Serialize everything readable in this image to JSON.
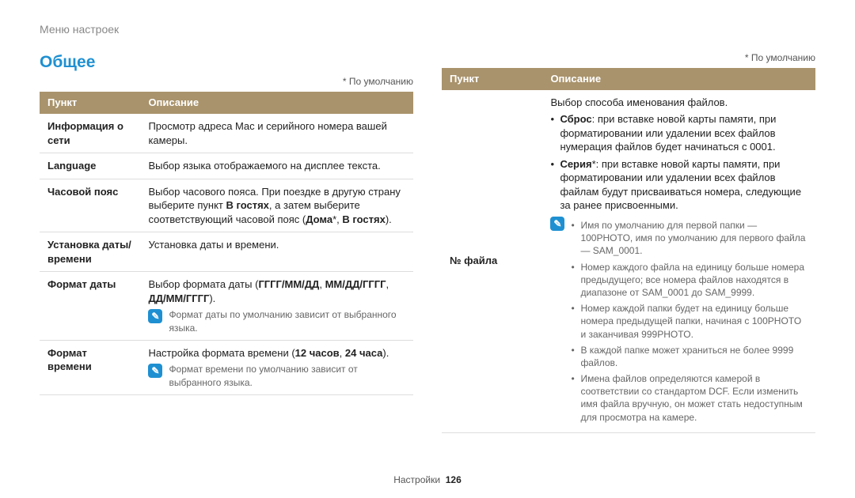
{
  "breadcrumb": "Меню настроек",
  "heading": "Общее",
  "default_note": "* По умолчанию",
  "header_item": "Пункт",
  "header_desc": "Описание",
  "footer_section": "Настройки",
  "footer_page": "126",
  "left": {
    "r0_item": "Информация о сети",
    "r0_desc": "Просмотр адреса Mac и серийного номера вашей камеры.",
    "r1_item": "Language",
    "r1_desc": "Выбор языка отображаемого на дисплее текста.",
    "r2_item": "Часовой пояс",
    "r2_desc_a": "Выбор часового пояса. При поездке в другую страну выберите пункт ",
    "r2_desc_b": "В гостях",
    "r2_desc_c": ", а затем выберите соответствующий часовой пояс (",
    "r2_desc_d": "Дома",
    "r2_desc_e": "*, ",
    "r2_desc_f": "В гостях",
    "r2_desc_g": ").",
    "r3_item": "Установка даты/времени",
    "r3_desc": "Установка даты и времени.",
    "r4_item": "Формат даты",
    "r4_desc_a": "Выбор формата даты (",
    "r4_desc_b": "ГГГГ/ММ/ДД",
    "r4_desc_c": ", ",
    "r4_desc_d": "ММ/ДД/ГГГГ",
    "r4_desc_e": ", ",
    "r4_desc_f": "ДД/ММ/ГГГГ",
    "r4_desc_g": ").",
    "r4_note": "Формат даты по умолчанию зависит от выбранного языка.",
    "r5_item": "Формат времени",
    "r5_desc_a": "Настройка формата времени (",
    "r5_desc_b": "12 часов",
    "r5_desc_c": ", ",
    "r5_desc_d": "24 часа",
    "r5_desc_e": ").",
    "r5_note": "Формат времени по умолчанию зависит от выбранного языка."
  },
  "right": {
    "r0_item": "№ файла",
    "r0_intro": "Выбор способа именования файлов.",
    "r0_li1_a": "Сброс",
    "r0_li1_b": ": при вставке новой карты памяти, при форматировании или удалении всех файлов нумерация файлов будет начинаться с 0001.",
    "r0_li2_a": "Серия",
    "r0_li2_b": "*: при вставке новой карты памяти, при форматировании или удалении всех файлов файлам будут присваиваться номера, следующие за ранее присвоенными.",
    "r0_note1": "Имя по умолчанию для первой папки — 100PHOTO, имя по умолчанию для первого файла — SAM_0001.",
    "r0_note2": "Номер каждого файла на единицу больше номера предыдущего; все номера файлов находятся в диапазоне от SAM_0001 до SAM_9999.",
    "r0_note3": "Номер каждой папки будет на единицу больше номера предыдущей папки, начиная с 100PHOTO и заканчивая 999PHOTO.",
    "r0_note4": "В каждой папке может храниться не более 9999 файлов.",
    "r0_note5": "Имена файлов определяются камерой в соответствии со стандартом DCF. Если изменить имя файла вручную, он может стать недоступным для просмотра на камере."
  }
}
